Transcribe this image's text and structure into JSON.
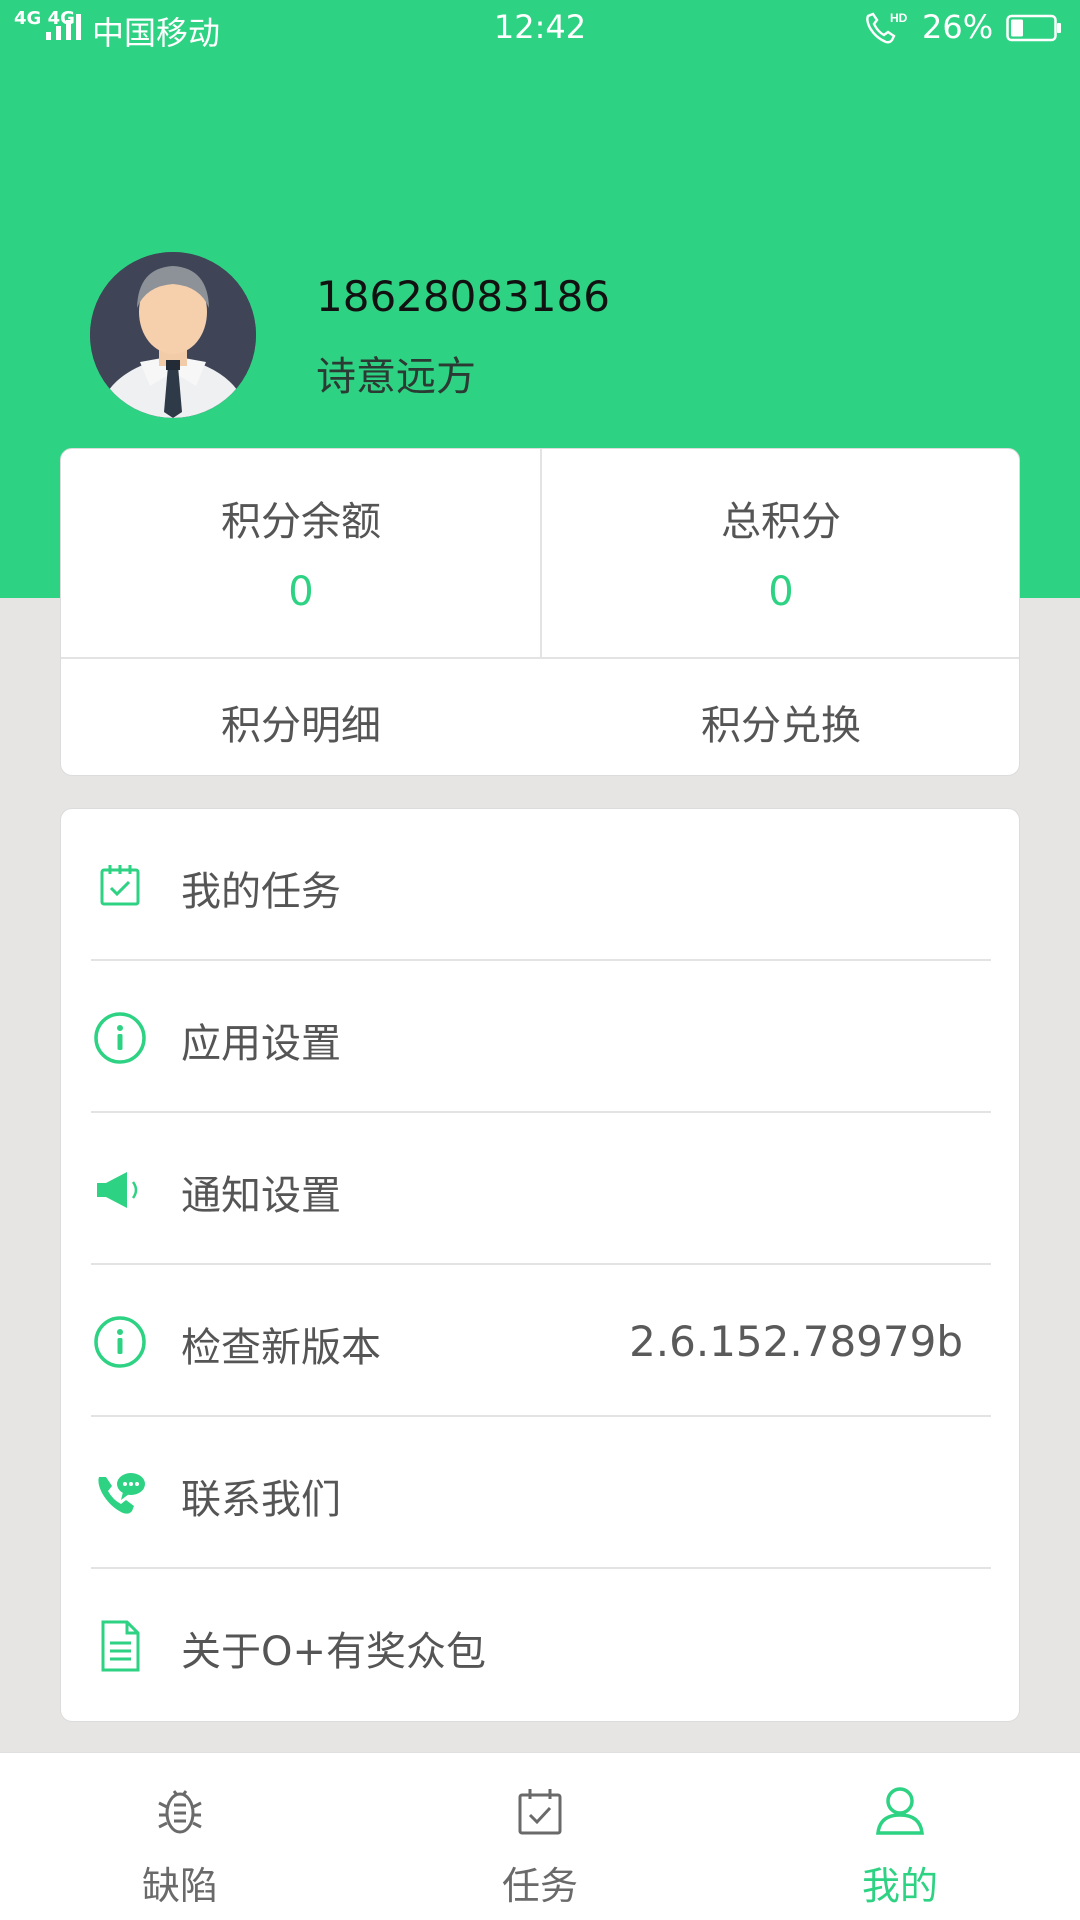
{
  "status_bar": {
    "network": "4G 4G",
    "carrier": "中国移动",
    "time": "12:42",
    "battery": "26%"
  },
  "profile": {
    "phone": "18628083186",
    "nickname": "诗意远方"
  },
  "points": {
    "balance_label": "积分余额",
    "balance_value": "0",
    "total_label": "总积分",
    "total_value": "0",
    "detail_label": "积分明细",
    "exchange_label": "积分兑换"
  },
  "menu": {
    "items": [
      {
        "label": "我的任务",
        "icon": "task-calendar-icon"
      },
      {
        "label": "应用设置",
        "icon": "info-circle-icon"
      },
      {
        "label": "通知设置",
        "icon": "speaker-icon"
      },
      {
        "label": "检查新版本",
        "icon": "info-circle-icon",
        "value": "2.6.152.78979b"
      },
      {
        "label": "联系我们",
        "icon": "phone-chat-icon"
      },
      {
        "label": "关于O+有奖众包",
        "icon": "document-icon"
      }
    ]
  },
  "bottom_nav": {
    "items": [
      {
        "label": "缺陷",
        "icon": "bug-icon",
        "active": false
      },
      {
        "label": "任务",
        "icon": "task-calendar-icon",
        "active": false
      },
      {
        "label": "我的",
        "icon": "person-icon",
        "active": true
      }
    ]
  },
  "colors": {
    "accent": "#2ed283",
    "page_bg": "#e6e5e3",
    "card_bg": "#ffffff",
    "label_text": "#555555"
  }
}
